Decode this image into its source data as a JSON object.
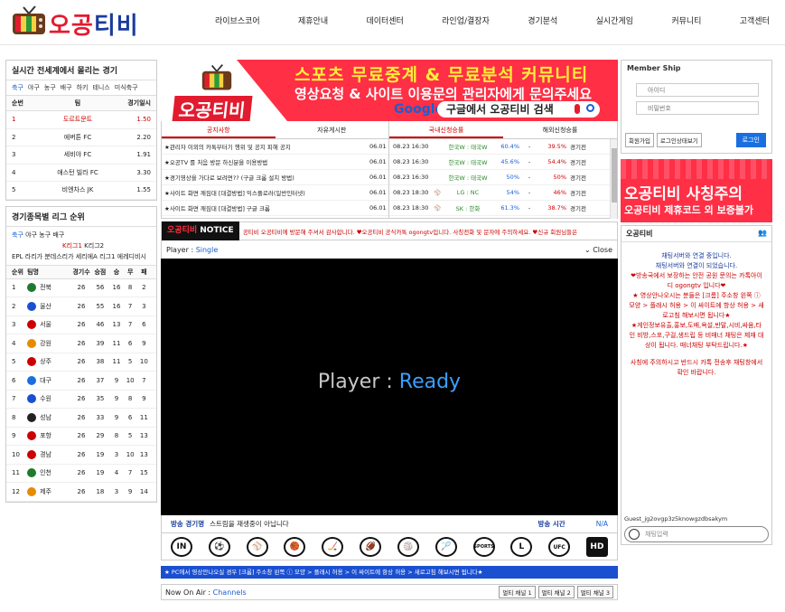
{
  "brand": {
    "name": "오공티비"
  },
  "nav": [
    "라이브스코어",
    "제휴안내",
    "데이터센터",
    "라인업/결장자",
    "경기분석",
    "실시간게임",
    "커뮤니티",
    "고객센터"
  ],
  "popular": {
    "title": "실시간 전세계에서 몰리는 경기",
    "tabs": [
      "축구",
      "야구",
      "농구",
      "배구",
      "하키",
      "테니스",
      "미식축구"
    ],
    "headers": [
      "순번",
      "팀",
      "경기일시"
    ],
    "rows": [
      {
        "rank": "1",
        "team": "도르트문트",
        "odds": "1.50"
      },
      {
        "rank": "2",
        "team": "에버튼 FC",
        "odds": "2.20"
      },
      {
        "rank": "3",
        "team": "세비야 FC",
        "odds": "1.91"
      },
      {
        "rank": "4",
        "team": "애스턴 빌라 FC",
        "odds": "3.30"
      },
      {
        "rank": "5",
        "team": "비엔차스 JK",
        "odds": "1.55"
      }
    ]
  },
  "league": {
    "title": "경기종목별 리그 순위",
    "tabs": [
      "축구",
      "야구",
      "농구",
      "배구"
    ],
    "sub1": "K리그1",
    "sub2": "K리그2",
    "sub3": "EPL 라리가 분데스리가 세리에A 리그1 에레디비시",
    "headers": [
      "순위",
      "팀명",
      "경기수",
      "승점",
      "승",
      "무",
      "패"
    ],
    "rows": [
      {
        "r": "1",
        "t": "전북",
        "g": "26",
        "p": "56",
        "w": "16",
        "d": "8",
        "l": "2",
        "c": "#1f7a2e"
      },
      {
        "r": "2",
        "t": "울산",
        "g": "26",
        "p": "55",
        "w": "16",
        "d": "7",
        "l": "3",
        "c": "#1a4fd0"
      },
      {
        "r": "3",
        "t": "서울",
        "g": "26",
        "p": "46",
        "w": "13",
        "d": "7",
        "l": "6",
        "c": "#c00"
      },
      {
        "r": "4",
        "t": "강원",
        "g": "26",
        "p": "39",
        "w": "11",
        "d": "6",
        "l": "9",
        "c": "#e88a00"
      },
      {
        "r": "5",
        "t": "상주",
        "g": "26",
        "p": "38",
        "w": "11",
        "d": "5",
        "l": "10",
        "c": "#c00"
      },
      {
        "r": "6",
        "t": "대구",
        "g": "26",
        "p": "37",
        "w": "9",
        "d": "10",
        "l": "7",
        "c": "#1a6fe0"
      },
      {
        "r": "7",
        "t": "수원",
        "g": "26",
        "p": "35",
        "w": "9",
        "d": "8",
        "l": "9",
        "c": "#1a4fd0"
      },
      {
        "r": "8",
        "t": "성남",
        "g": "26",
        "p": "33",
        "w": "9",
        "d": "6",
        "l": "11",
        "c": "#222"
      },
      {
        "r": "9",
        "t": "포항",
        "g": "26",
        "p": "29",
        "w": "8",
        "d": "5",
        "l": "13",
        "c": "#c00"
      },
      {
        "r": "10",
        "t": "경남",
        "g": "26",
        "p": "19",
        "w": "3",
        "d": "10",
        "l": "13",
        "c": "#c00"
      },
      {
        "r": "11",
        "t": "인천",
        "g": "26",
        "p": "19",
        "w": "4",
        "d": "7",
        "l": "15",
        "c": "#1f7a2e"
      },
      {
        "r": "12",
        "t": "제주",
        "g": "26",
        "p": "18",
        "w": "3",
        "d": "9",
        "l": "14",
        "c": "#e88a00"
      }
    ]
  },
  "banner": {
    "line1": "스포츠 무료중계 & 무료분석 커뮤니티",
    "line2": "영상요청 & 사이트 이용문의 관리자에게 문의주세요",
    "brand": "오공티비",
    "google": "Google",
    "search": "구글에서 오공티비 검색"
  },
  "info": {
    "tabs": [
      "공지사항",
      "자유게시판"
    ],
    "notices": [
      {
        "t": "★관리자 이외의 카톡부터기 행위 및 공지 피해 공지",
        "d": "06.01"
      },
      {
        "t": "★오공TV 를 처음 방문 하신분을 이용방법",
        "d": "06.01"
      },
      {
        "t": "★경기영상을 가다로 보려면?? (구글 크롬 설치 방법)",
        "d": "06.01"
      },
      {
        "t": "★사이트 화면 깨짐대 [대결방법] 익스플로러(일반인터넷)",
        "d": "06.01"
      },
      {
        "t": "★사이트 화면 깨짐대 [대결방법] 구글 크롬",
        "d": "06.01"
      }
    ],
    "mtabs": [
      "국내신청승률",
      "해외신청승률"
    ],
    "matches": [
      {
        "tm": "08.23 16:30",
        "mt": "한국W : 태국W",
        "p1": "60.4%",
        "sp": "-",
        "p2": "39.5%",
        "st": "경기전"
      },
      {
        "tm": "08.23 16:30",
        "mt": "한국W : 태국W",
        "p1": "45.6%",
        "sp": "-",
        "p2": "54.4%",
        "st": "경기전"
      },
      {
        "tm": "08.23 16:30",
        "mt": "한국W : 태국W",
        "p1": "50%",
        "sp": "-",
        "p2": "50%",
        "st": "경기전"
      },
      {
        "tm": "08.23 18:30",
        "mt": "LG : NC",
        "p1": "54%",
        "sp": "-",
        "p2": "46%",
        "st": "경기전"
      },
      {
        "tm": "08.23 18:30",
        "mt": "SK : 한화",
        "p1": "61.3%",
        "sp": "-",
        "p2": "38.7%",
        "st": "경기전"
      }
    ]
  },
  "notice": {
    "label1": "오공티비",
    "label2": "NOTICE",
    "text": "공티비 오공티비에 방문해 주셔서 감사합니다.   ♥오공티비 공식카톡 ogongtv입니다. 사칭전화 및 문자에 주의하세요.   ♥신규 회원님들은"
  },
  "player": {
    "label": "Player : ",
    "mode": "Single",
    "close": "Close",
    "ready1": "Player : ",
    "ready2": "Ready"
  },
  "broadcast": {
    "name_label": "방송 경기명",
    "name_value": "스트림을 재생중이 아닙니다",
    "time_label": "방송 시간",
    "time_value": "N/A"
  },
  "sport_icons": [
    "IN",
    "⚽",
    "⚾",
    "🏀",
    "🏒",
    "🏈",
    "🏐",
    "🏸",
    "SPORTS",
    "L",
    "UFC",
    "HD"
  ],
  "bluebar": "★ PC에서 영상안나오실 경우 [크롬] 주소창 왼쪽 ⓘ 모양 > 플래시 허용 > 이 싸이트에 항상 허용 > 새로고침 해보시면 됩니다★",
  "onair": {
    "label": "Now On Air : ",
    "channel": "Channels",
    "multi": [
      "멀티 채널 1",
      "멀티 채널 2",
      "멀티 채널 3"
    ]
  },
  "login": {
    "title": "Member Ship",
    "id_placeholder": "아이디",
    "pw_placeholder": "비밀번호",
    "join": "회원가입",
    "keep": "로그인상태보기",
    "submit": "로그인"
  },
  "warn": {
    "line1": "오공티비 사칭주의",
    "line2": "오공티비 제휴코드 외 보증불가"
  },
  "chat": {
    "title": "오공티비",
    "l1": "채팅서버와 연결 중입니다.",
    "l2": "채팅서버와 연결이 되었습니다.",
    "l3": "❤방송국에서 보장하는 안전 공원 문의는 카톡아이디 ogongtv 입니다❤",
    "l4": "★ 영상안나오시는 분들은 [크롬] 주소창 왼쪽 ⓘ 모양 > 플래시 허용 > 이 싸이트에 항상 허용 > 새로고침 해보시면 됩니다★",
    "l5": "★게인정보유출,홍보,도배,욕설,반말,시비,싸움,타인 비방,스포,구걸,생드립 등 비매너 채팅은 제재 대상이 됩니다. 매너채팅 부탁드립니다.★",
    "l6": "사칭에 주의하시고 반드시 카톡 전송후 채팅창에서 확인 바랍니다.",
    "user": "Guest_jg2ovgp3z5knowgzdbsakym",
    "placeholder": "채팅입력"
  }
}
